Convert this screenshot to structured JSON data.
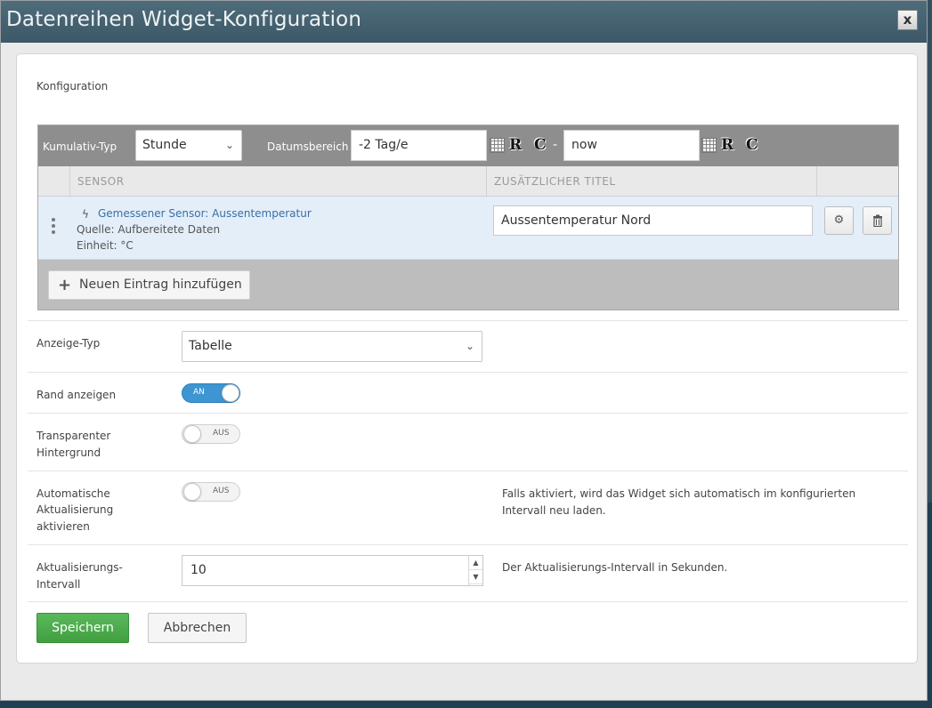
{
  "dialog": {
    "title": "Datenreihen Widget-Konfiguration",
    "close_label": "x"
  },
  "config": {
    "section_label": "Konfiguration",
    "toolbar": {
      "cumulative_type_label": "Kumulativ-Typ",
      "cumulative_type_value": "Stunde",
      "date_range_label": "Datumsbereich",
      "date_from": "-2 Tag/e",
      "date_separator": "-",
      "date_to": "now",
      "relative_icon_label": "R",
      "clear_icon_label": "C"
    },
    "table": {
      "col_sensor": "SENSOR",
      "col_title": "ZUSÄTZLICHER TITEL",
      "rows": [
        {
          "sensor_name": "Gemessener Sensor: Aussentemperatur",
          "source": "Quelle: Aufbereitete Daten",
          "unit": "Einheit: °C",
          "extra_title": "Aussentemperatur Nord"
        }
      ]
    },
    "add_entry_label": "Neuen Eintrag hinzufügen"
  },
  "form": {
    "display_type": {
      "label": "Anzeige-Typ",
      "value": "Tabelle"
    },
    "show_border": {
      "label": "Rand anzeigen",
      "state": "AN"
    },
    "transparent_bg": {
      "label_line1": "Transparenter",
      "label_line2": "Hintergrund",
      "state": "AUS"
    },
    "auto_refresh": {
      "label_line1": "Automatische",
      "label_line2": "Aktualisierung",
      "label_line3": "aktivieren",
      "state": "AUS",
      "help_line1": "Falls aktiviert, wird das Widget sich automatisch im konfigurierten",
      "help_line2": "Intervall neu laden."
    },
    "refresh_interval": {
      "label_line1": "Aktualisierungs-",
      "label_line2": "Intervall",
      "value": "10",
      "help": "Der Aktualisierungs-Intervall in Sekunden."
    }
  },
  "buttons": {
    "save": "Speichern",
    "cancel": "Abbrechen"
  },
  "colors": {
    "accent": "#3d95d1",
    "save": "#4cae4c",
    "link": "#3a6fa8"
  }
}
